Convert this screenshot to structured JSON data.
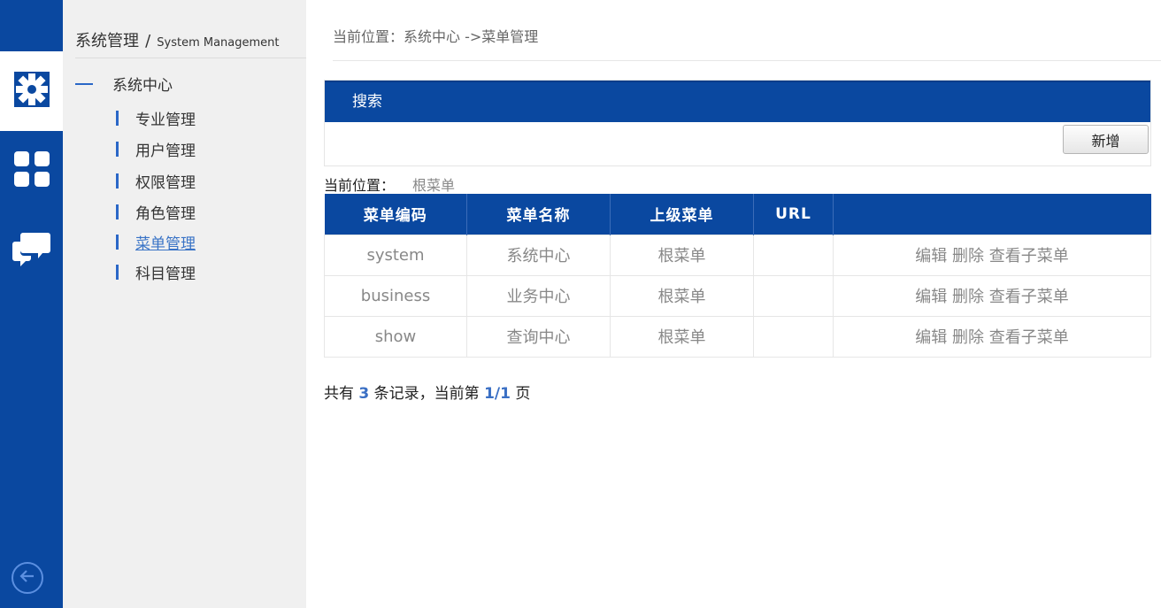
{
  "colors": {
    "primary": "#0a48a0",
    "accent": "#2a67c7",
    "link": "#3973c6",
    "muted": "#888888"
  },
  "rail": {
    "items": [
      {
        "icon": "gear-icon",
        "active": true
      },
      {
        "icon": "dashboard-grid-icon",
        "active": false
      },
      {
        "icon": "chat-bubbles-icon",
        "active": false
      }
    ],
    "back_icon": "back-arrow-icon"
  },
  "sidebar": {
    "title": "系统管理",
    "separator": "/",
    "subtitle": "System Management",
    "group_label": "系统中心",
    "items": [
      {
        "label": "专业管理"
      },
      {
        "label": "用户管理"
      },
      {
        "label": "权限管理"
      },
      {
        "label": "角色管理"
      },
      {
        "label": "菜单管理",
        "active": true
      },
      {
        "label": "科目管理"
      }
    ]
  },
  "breadcrumb": "当前位置：系统中心 ->菜单管理",
  "search": {
    "title": "搜索",
    "add_button": "新增"
  },
  "location": {
    "label": "当前位置：",
    "value": "根菜单"
  },
  "table": {
    "headers": [
      "菜单编码",
      "菜单名称",
      "上级菜单",
      "URL",
      ""
    ],
    "rows": [
      {
        "code": "system",
        "name": "系统中心",
        "parent": "根菜单",
        "url": "",
        "edit": "编辑",
        "delete": "删除",
        "children": "查看子菜单"
      },
      {
        "code": "business",
        "name": "业务中心",
        "parent": "根菜单",
        "url": "",
        "edit": "编辑",
        "delete": "删除",
        "children": "查看子菜单"
      },
      {
        "code": "show",
        "name": "查询中心",
        "parent": "根菜单",
        "url": "",
        "edit": "编辑",
        "delete": "删除",
        "children": "查看子菜单"
      }
    ]
  },
  "pager": {
    "prefix": "共有",
    "count": "3",
    "middle": "条记录，当前第",
    "page": "1/1",
    "suffix": "页"
  }
}
